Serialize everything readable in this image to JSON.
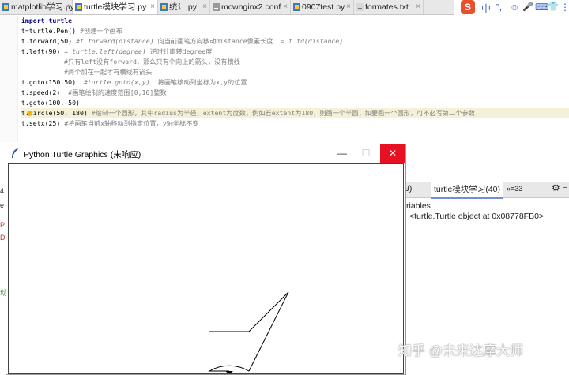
{
  "editor_tabs": [
    {
      "label": "matplotlib学习.py",
      "close": "×"
    },
    {
      "label": "turtle模块学习.py",
      "close": "×"
    },
    {
      "label": "统计.py",
      "close": "×"
    },
    {
      "label": "mcwnginx2.conf",
      "close": "×"
    },
    {
      "label": "0907test.py",
      "close": "×"
    },
    {
      "label": "formates.txt",
      "close": "×"
    }
  ],
  "ime_toolbar": {
    "logo": "S",
    "lang": "中",
    "punct": "°,",
    "emoji": "☺",
    "voice": "🎤",
    "keyboard": "⌨",
    "shirt": "👕",
    "grid": "⋮⋮"
  },
  "code_lines": [
    {
      "code": "import turtle"
    },
    {
      "code": "t=turtle.Pen()",
      "note": "#创建一个画布"
    },
    {
      "code": "t.forward(50)",
      "hint": "#t.forward(distance)",
      "note": "向当前画笔方向移动distance像素长度",
      "hint2": "= t.fd(distance)"
    },
    {
      "code": "t.left(90)",
      "hint": "= turtle.left(degree)",
      "note": "逆时针旋转degree度"
    },
    {
      "code": "",
      "note": "#只有left没有forward，那么只有个向上的箭头，没有横线"
    },
    {
      "code": "",
      "note": "#两个加在一起才有横线有箭头"
    },
    {
      "code": "t.goto(150,50)",
      "hint": "#turtle.goto(x,y)",
      "note": "将画笔移动到坐标为x,y的位置"
    },
    {
      "code": "t.speed(2)",
      "note": "#画笔绘制的速度范围[0,10]整数"
    },
    {
      "code": "t.goto(100,-50)"
    },
    {
      "code": "t.circle(50, 180)",
      "note": "#绘制一个圆形，其中radius为半径，extent为度数，例如若extent为180，则画一个半圆；如要画一个圆形，可不必写第二个参数"
    },
    {
      "code": "t.setx(25)",
      "note": "#将画笔当前x轴移动到指定位置，y轴坐标不变"
    }
  ],
  "right_panel": {
    "tab_left": "9)",
    "tab_active": "turtle模块学习(40)",
    "tab_extra": "»≡33",
    "gear": "⚙",
    "minus": "–",
    "section": "riables",
    "value": "<turtle.Turtle object at 0x08778FB0>"
  },
  "turtle_window": {
    "title": "Python Turtle Graphics (未响应)",
    "minimize": "—",
    "maximize": "☐",
    "close": "✕"
  },
  "left_strip": {
    "frag1": "4",
    "frag2": "e",
    "frag3": "P",
    "frag4": "D",
    "frag5": "动"
  },
  "watermark": "知乎 @未来达摩大师"
}
